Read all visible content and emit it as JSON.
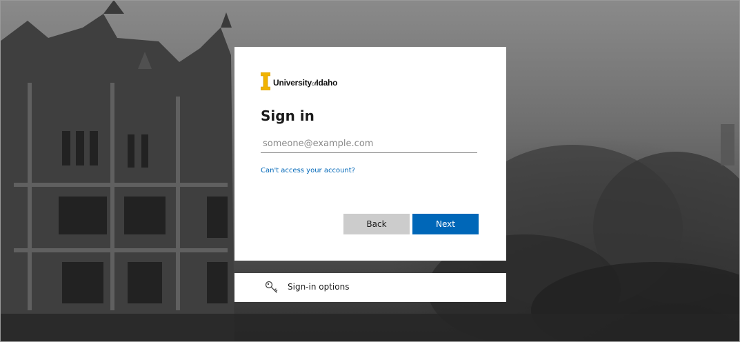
{
  "logo": {
    "text_main": "University",
    "text_of": "of",
    "text_end": "Idaho",
    "color": "#f1b300"
  },
  "signin": {
    "title": "Sign in",
    "email_placeholder": "someone@example.com",
    "email_value": "",
    "cant_access_link": "Can't access your account?",
    "back_label": "Back",
    "next_label": "Next"
  },
  "options": {
    "label": "Sign-in options",
    "icon": "key-icon"
  },
  "colors": {
    "primary": "#0067b8",
    "secondary_button": "#cccccc",
    "card": "#ffffff"
  }
}
